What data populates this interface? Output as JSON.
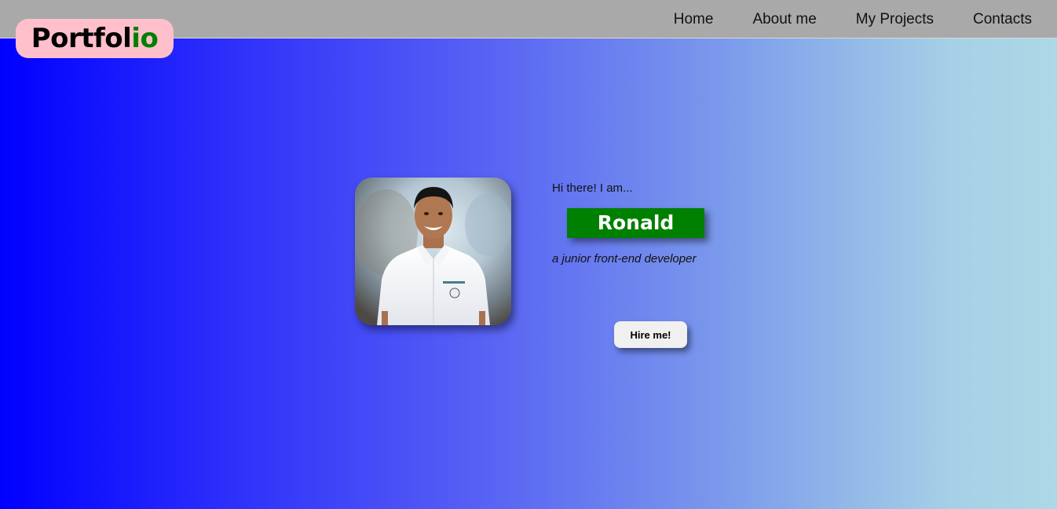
{
  "header": {
    "logo_main": "Portfol",
    "logo_accent": "io",
    "nav": {
      "home": "Home",
      "about": "About me",
      "projects": "My Projects",
      "contacts": "Contacts"
    }
  },
  "hero": {
    "greeting": "Hi there! I am...",
    "name": "Ronald",
    "tagline": "a junior front-end developer",
    "cta_label": "Hire me!",
    "photo_icon": "profile-photo"
  },
  "colors": {
    "header_bg": "#a9a9a9",
    "logo_bg": "#ffc0cb",
    "accent_green": "#008000",
    "gradient_start": "#0000ff",
    "gradient_end": "#add8e6",
    "button_bg": "#f0f0f0"
  }
}
